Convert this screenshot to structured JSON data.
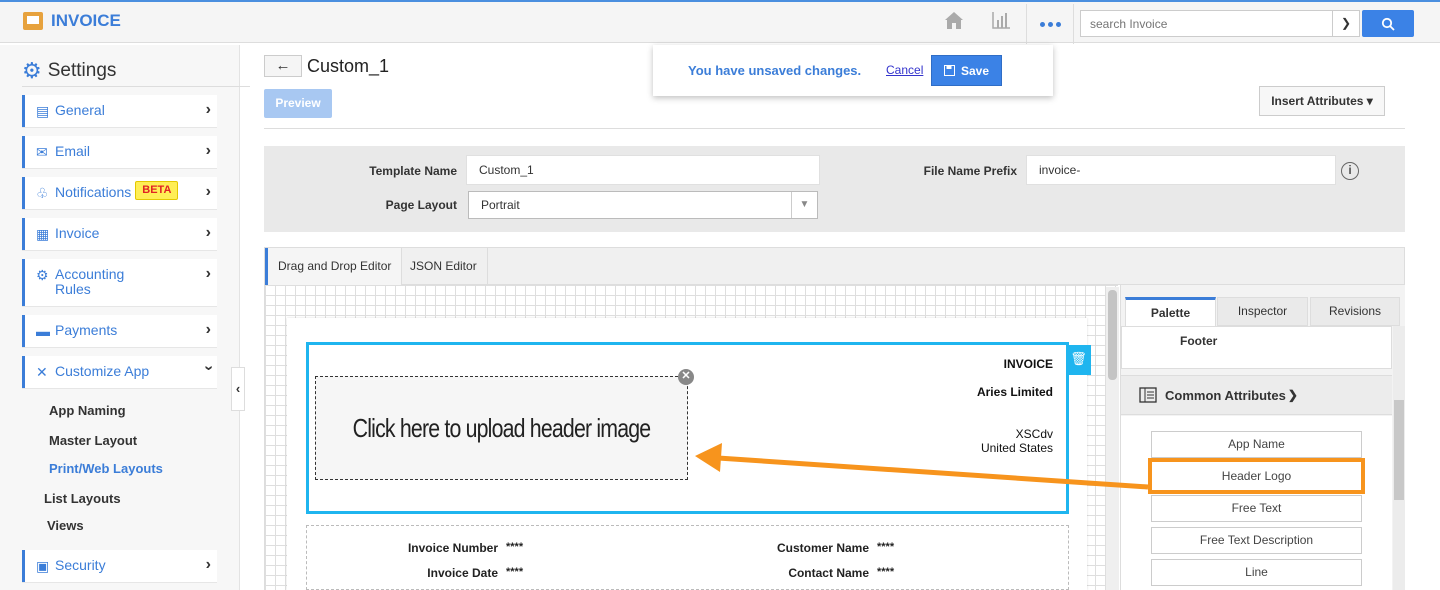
{
  "app": {
    "title": "INVOICE"
  },
  "header": {
    "search_placeholder": "search Invoice",
    "icons": [
      "home-icon",
      "bar-chart-icon",
      "more-dots-icon",
      "search-icon"
    ]
  },
  "sidebar": {
    "title": "Settings",
    "items": [
      {
        "label": "General",
        "icon": "monitor-icon"
      },
      {
        "label": "Email",
        "icon": "envelope-icon"
      },
      {
        "label": "Notifications",
        "icon": "bell-icon",
        "badge": "BETA"
      },
      {
        "label": "Invoice",
        "icon": "invoice-icon"
      },
      {
        "label": "Accounting\nRules",
        "icon": "rules-icon"
      },
      {
        "label": "Payments",
        "icon": "credit-card-icon"
      },
      {
        "label": "Customize App",
        "icon": "tools-icon"
      },
      {
        "label": "Security",
        "icon": "lock-icon"
      }
    ],
    "subitems": [
      "App Naming",
      "Master Layout",
      "Print/Web Layouts",
      "List Layouts",
      "Views"
    ],
    "active_subitem": "Print/Web Layouts"
  },
  "main": {
    "title": "Custom_1",
    "preview_label": "Preview",
    "insert_attributes_label": "Insert Attributes",
    "unsaved": {
      "message": "You have unsaved changes.",
      "cancel": "Cancel",
      "save": "Save"
    },
    "form": {
      "template_name_label": "Template Name",
      "template_name_value": "Custom_1",
      "page_layout_label": "Page Layout",
      "page_layout_value": "Portrait",
      "file_prefix_label": "File Name Prefix",
      "file_prefix_value": "invoice-"
    },
    "tabs": [
      "Drag and Drop Editor",
      "JSON Editor"
    ]
  },
  "canvas": {
    "upload_text": "Click here to upload header image",
    "invoice_title": "INVOICE",
    "company": "Aries Limited",
    "address_line1": "XSCdv",
    "address_line2": "United States",
    "fields": {
      "invoice_number_label": "Invoice Number",
      "invoice_number_value": "****",
      "invoice_date_label": "Invoice Date",
      "invoice_date_value": "****",
      "customer_name_label": "Customer Name",
      "customer_name_value": "****",
      "contact_name_label": "Contact Name",
      "contact_name_value": "****"
    }
  },
  "palette": {
    "tabs": [
      "Palette",
      "Inspector",
      "Revisions"
    ],
    "footer_label": "Footer",
    "common_attributes_label": "Common Attributes",
    "attributes": [
      "App Name",
      "Header Logo",
      "Free Text",
      "Free Text Description",
      "Line"
    ],
    "highlighted": "Header Logo"
  },
  "colors": {
    "accent": "#3b7dd8",
    "highlight": "#f7941d",
    "selection": "#1fb5ef",
    "beta_bg": "#ffee55"
  }
}
